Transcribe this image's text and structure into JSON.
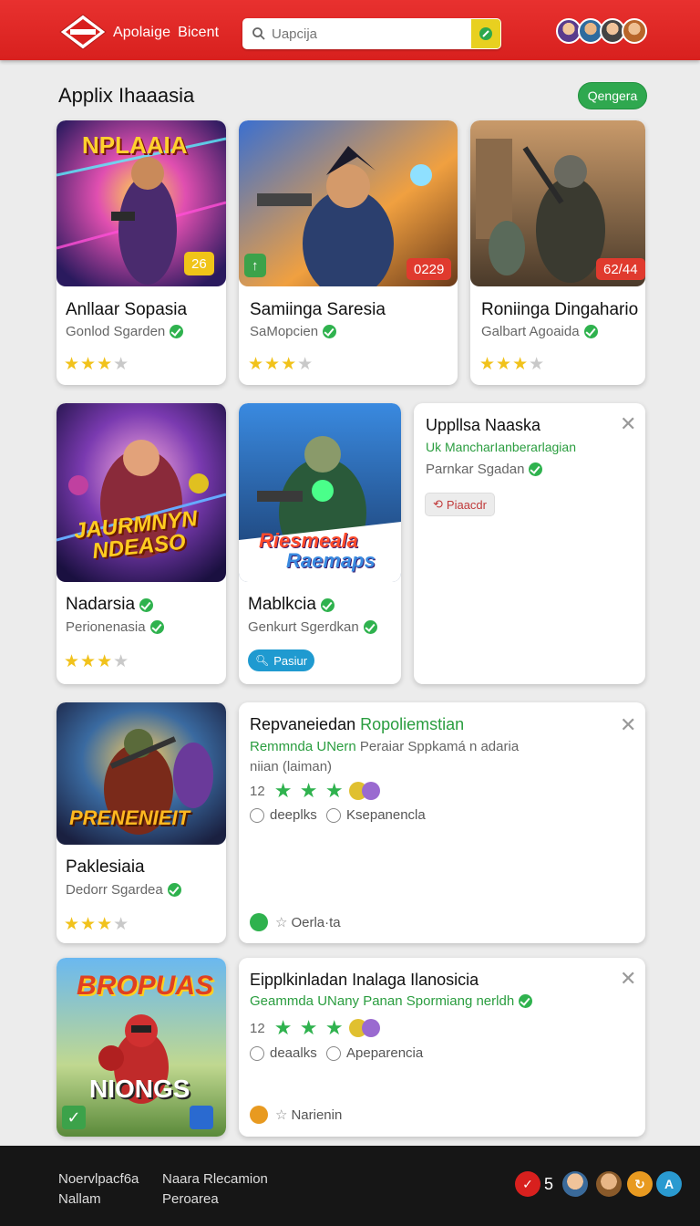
{
  "header": {
    "brand_primary": "Apolaige",
    "brand_secondary": "Bicent",
    "search_placeholder": "Uapcija",
    "accent": "#e02a28"
  },
  "section": {
    "title": "Applix Ihaaasia",
    "action_label": "Qengera"
  },
  "row1": [
    {
      "title": "Anllaar Sopasia",
      "subtitle": "Gonlod Sgarden",
      "rating": 3,
      "art_text": "NPLAAIA",
      "badge": "26",
      "badge_color": "#f0c418"
    },
    {
      "title": "Samiinga Saresia",
      "subtitle": "SaMopcien",
      "rating": 3,
      "badge": "0229",
      "badge_color": "#e03a2e",
      "icon_badge": "↑"
    },
    {
      "title": "Roniinga Dingahario",
      "subtitle": "Galbart Agoaida",
      "rating": 3,
      "badge": "62/44",
      "badge_color": "#e03a2e"
    }
  ],
  "row2": [
    {
      "title": "Nadarsia",
      "subtitle": "Perionenasia",
      "rating": 3,
      "art_text_1": "JAURMNYN",
      "art_text_2": "NDEASO"
    },
    {
      "title": "Mablkcia",
      "subtitle": "Genkurt Sgerdkan",
      "button": "Pasiur",
      "art_text_1": "Riesmeala",
      "art_text_2": "Raemaps"
    },
    {
      "title": "Uppllsa Naaska",
      "subtitle_green": "Uk MancharIanberarlagian",
      "subtitle": "Parnkar Sgadan",
      "tag": "Piaacdr"
    }
  ],
  "row3": {
    "game": {
      "title": "Paklesiaia",
      "subtitle": "Dedorr Sgardea",
      "rating": 3,
      "art_text": "PRENENIEIT"
    },
    "detail": {
      "title_a": "Repvaneiedan",
      "title_b": "Ropoliemstian",
      "sub_green": "Remmnda UNern",
      "sub_rest": "Peraiar Sppkamá n adaria",
      "sub_line2": "niian (laiman)",
      "count": "12",
      "option_1": "deeplks",
      "option_2": "Ksepanencla",
      "footer": "Oerla·ta"
    }
  },
  "row4": {
    "game": {
      "art_text": "BROPUAS",
      "art_text_2": "NIONGS"
    },
    "detail": {
      "title": "Eipplkinladan Inalaga Ilanosicia",
      "sub_green": "Geammda UNany Panan Spormiang nerldh",
      "count": "12",
      "option_1": "deaalks",
      "option_2": "Apeparencia",
      "footer": "Narienin"
    }
  },
  "footer": {
    "col1_line1": "Noervlpacf6a",
    "col1_line2": "Nallam",
    "col2_line1": "Naara Rlecamion",
    "col2_line2": "Peroarea",
    "count": "5"
  }
}
